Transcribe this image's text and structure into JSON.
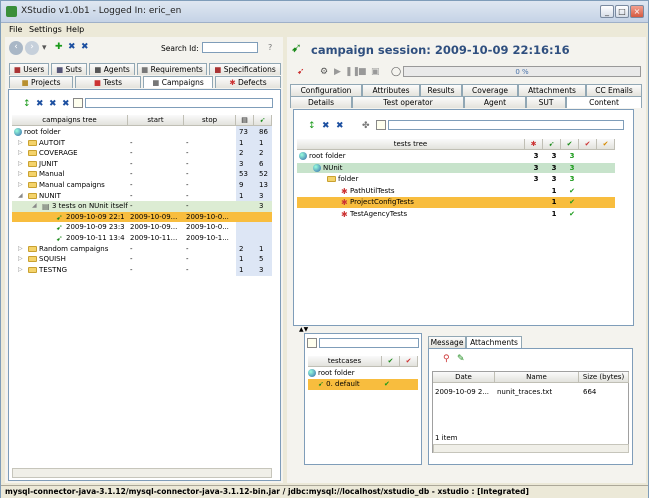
{
  "window": {
    "title": "XStudio v1.0b1 - Logged In: eric_en"
  },
  "menu": [
    "File",
    "Settings",
    "Help"
  ],
  "left": {
    "search_label": "Search Id:",
    "help": "?",
    "tabs_row1": [
      "Users",
      "Suts",
      "Agents",
      "Requirements",
      "Specifications"
    ],
    "tabs_row2": [
      "Projects",
      "Tests",
      "Campaigns",
      "Defects"
    ],
    "columns": [
      "campaigns tree",
      "start",
      "stop"
    ],
    "tree": [
      {
        "label": "root folder",
        "start": "",
        "stop": "",
        "a": "73",
        "b": "86",
        "level": 0,
        "icon": "globe"
      },
      {
        "label": "AUTOIT",
        "start": "-",
        "stop": "-",
        "a": "1",
        "b": "1",
        "level": 1,
        "icon": "folder"
      },
      {
        "label": "COVERAGE",
        "start": "-",
        "stop": "-",
        "a": "2",
        "b": "2",
        "level": 1,
        "icon": "folder"
      },
      {
        "label": "JUNIT",
        "start": "-",
        "stop": "-",
        "a": "3",
        "b": "6",
        "level": 1,
        "icon": "folder"
      },
      {
        "label": "Manual",
        "start": "-",
        "stop": "-",
        "a": "53",
        "b": "52",
        "level": 1,
        "icon": "folder"
      },
      {
        "label": "Manual campaigns",
        "start": "-",
        "stop": "-",
        "a": "9",
        "b": "13",
        "level": 1,
        "icon": "folder"
      },
      {
        "label": "NUNIT",
        "start": "-",
        "stop": "-",
        "a": "1",
        "b": "3",
        "level": 1,
        "icon": "folder"
      },
      {
        "label": "3 tests on NUnit itself",
        "start": "-",
        "stop": "-",
        "a": "",
        "b": "3",
        "level": 2,
        "icon": "campaign"
      },
      {
        "label": "2009-10-09 22:1",
        "start": "2009-10-09...",
        "stop": "2009-10-0...",
        "a": "",
        "b": "",
        "level": 3,
        "icon": "runner"
      },
      {
        "label": "2009-10-09 23:3",
        "start": "2009-10-09...",
        "stop": "2009-10-0...",
        "a": "",
        "b": "",
        "level": 3,
        "icon": "runner"
      },
      {
        "label": "2009-10-11 13:4",
        "start": "2009-10-11...",
        "stop": "2009-10-1...",
        "a": "",
        "b": "",
        "level": 3,
        "icon": "runner"
      },
      {
        "label": "Random campaigns",
        "start": "-",
        "stop": "-",
        "a": "2",
        "b": "1",
        "level": 1,
        "icon": "folder"
      },
      {
        "label": "SQUISH",
        "start": "-",
        "stop": "-",
        "a": "1",
        "b": "5",
        "level": 1,
        "icon": "folder"
      },
      {
        "label": "TESTNG",
        "start": "-",
        "stop": "-",
        "a": "1",
        "b": "3",
        "level": 1,
        "icon": "folder"
      }
    ]
  },
  "right": {
    "title": "campaign session: 2009-10-09 22:16:16",
    "progress": {
      "label": "0 %",
      "fraction": 0
    },
    "tabs_row1": [
      "Configuration",
      "Attributes",
      "Results",
      "Coverage",
      "Attachments",
      "CC Emails"
    ],
    "tabs_row2": [
      "Details",
      "Test operator",
      "Agent",
      "SUT",
      "Content"
    ],
    "tests_columns": [
      "tests tree"
    ],
    "tests_tree": [
      {
        "label": "root folder",
        "a": "3",
        "b": "3",
        "c": "3",
        "level": 0,
        "icon": "globe"
      },
      {
        "label": "NUnit",
        "a": "3",
        "b": "3",
        "c": "3",
        "level": 1,
        "icon": "globe"
      },
      {
        "label": "folder",
        "a": "3",
        "b": "3",
        "c": "3",
        "level": 2,
        "icon": "folder"
      },
      {
        "label": "PathUtilTests",
        "a": "",
        "b": "1",
        "c": "✔",
        "level": 3,
        "icon": "flask"
      },
      {
        "label": "ProjectConfigTests",
        "a": "",
        "b": "1",
        "c": "✔",
        "level": 3,
        "icon": "flask"
      },
      {
        "label": "TestAgencyTests",
        "a": "",
        "b": "1",
        "c": "✔",
        "level": 3,
        "icon": "flask"
      }
    ],
    "testcases": {
      "column": "testcases",
      "rows": [
        {
          "label": "root folder",
          "check": ""
        },
        {
          "label": "0. default",
          "check": "✔"
        }
      ]
    },
    "bottom_tabs": [
      "Message",
      "Attachments"
    ],
    "attachments": {
      "columns": [
        "Date",
        "Name",
        "Size (bytes)"
      ],
      "rows": [
        {
          "date": "2009-10-09 2...",
          "name": "nunit_traces.txt",
          "size": "664"
        }
      ],
      "count": "1 item"
    }
  },
  "status": "mysql-connector-java-3.1.12/mysql-connector-java-3.1.12-bin.jar / jdbc:mysql://localhost/xstudio_db - xstudio : [Integrated]"
}
